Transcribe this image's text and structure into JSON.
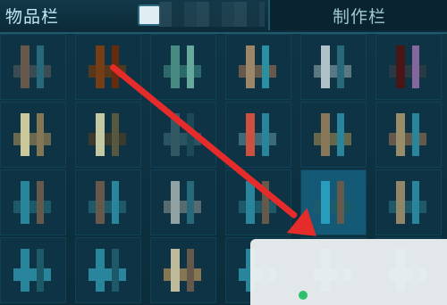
{
  "tabs": {
    "left_label": "物品栏",
    "right_label": "制作栏"
  },
  "colors": {
    "accent": "#bfe6f2",
    "arrow": "#e62b2b"
  },
  "icons": {
    "top_mini": "tray-icon"
  }
}
